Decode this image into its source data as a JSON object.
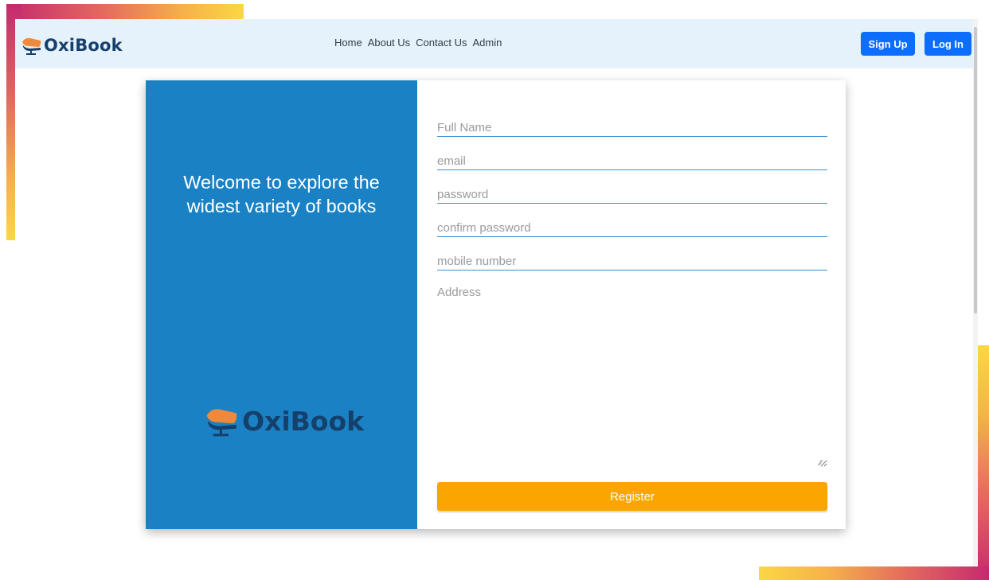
{
  "brand": {
    "name": "OxiBook",
    "icon": "book-desk-icon"
  },
  "nav": {
    "links": [
      "Home",
      "About Us",
      "Contact Us",
      "Admin"
    ],
    "signup_label": "Sign Up",
    "login_label": "Log In"
  },
  "hero": {
    "welcome_line1": "Welcome to explore the",
    "welcome_line2": "widest variety of books",
    "brand_name": "OxiBook"
  },
  "form": {
    "fullname_placeholder": "Full Name",
    "email_placeholder": "email",
    "password_placeholder": "password",
    "confirm_placeholder": "confirm password",
    "mobile_placeholder": "mobile number",
    "address_placeholder": "Address",
    "register_label": "Register"
  },
  "colors": {
    "panel_blue": "#1a82c4",
    "brand_navy": "#15406b",
    "brand_orange": "#f08a3a",
    "button_blue": "#0d6efd",
    "register_orange": "#fba500",
    "navbar_bg": "#e5f1fb"
  }
}
